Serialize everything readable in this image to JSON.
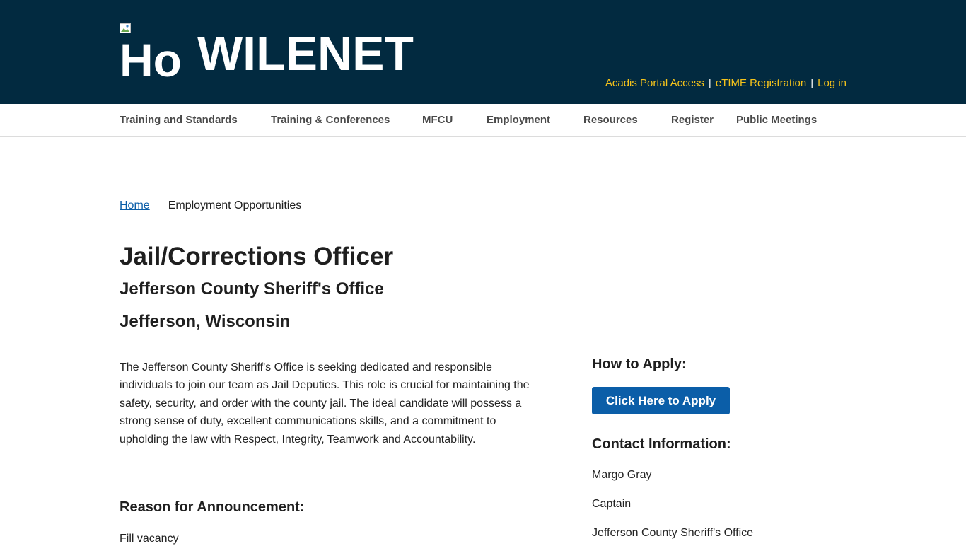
{
  "header": {
    "logo_alt": "Ho",
    "site_title": "WILENET",
    "top_links": [
      {
        "label": "Acadis Portal Access"
      },
      {
        "label": "eTIME Registration"
      },
      {
        "label": "Log in"
      }
    ],
    "separator": "|",
    "colors": {
      "background": "#022a40",
      "link": "#f5c31b"
    }
  },
  "nav": {
    "items": [
      {
        "label": "Training and Standards"
      },
      {
        "label": "Training & Conferences"
      },
      {
        "label": "MFCU"
      },
      {
        "label": "Employment"
      },
      {
        "label": "Resources"
      },
      {
        "label": "Register"
      },
      {
        "label": "Public Meetings"
      }
    ]
  },
  "breadcrumb": {
    "home": "Home",
    "current": "Employment Opportunities"
  },
  "job": {
    "title": "Jail/Corrections Officer",
    "agency": "Jefferson County Sheriff's Office",
    "location": "Jefferson, Wisconsin",
    "description": "The Jefferson County Sheriff's Office is seeking dedicated and responsible individuals to join our team as Jail Deputies. This role is crucial for maintaining the safety, security, and order with the county jail. The ideal candidate will possess a strong sense of duty, excellent communications skills, and a commitment to upholding the law with Respect, Integrity, Teamwork and Accountability.",
    "reason_heading": "Reason for Announcement:",
    "reason_text": "Fill vacancy"
  },
  "sidebar": {
    "apply_heading": "How to Apply:",
    "apply_button": "Click Here to Apply",
    "contact_heading": "Contact Information:",
    "contact_lines": [
      "Margo Gray",
      "Captain",
      "Jefferson County Sheriff's Office"
    ],
    "button_color": "#0b5ea8"
  }
}
